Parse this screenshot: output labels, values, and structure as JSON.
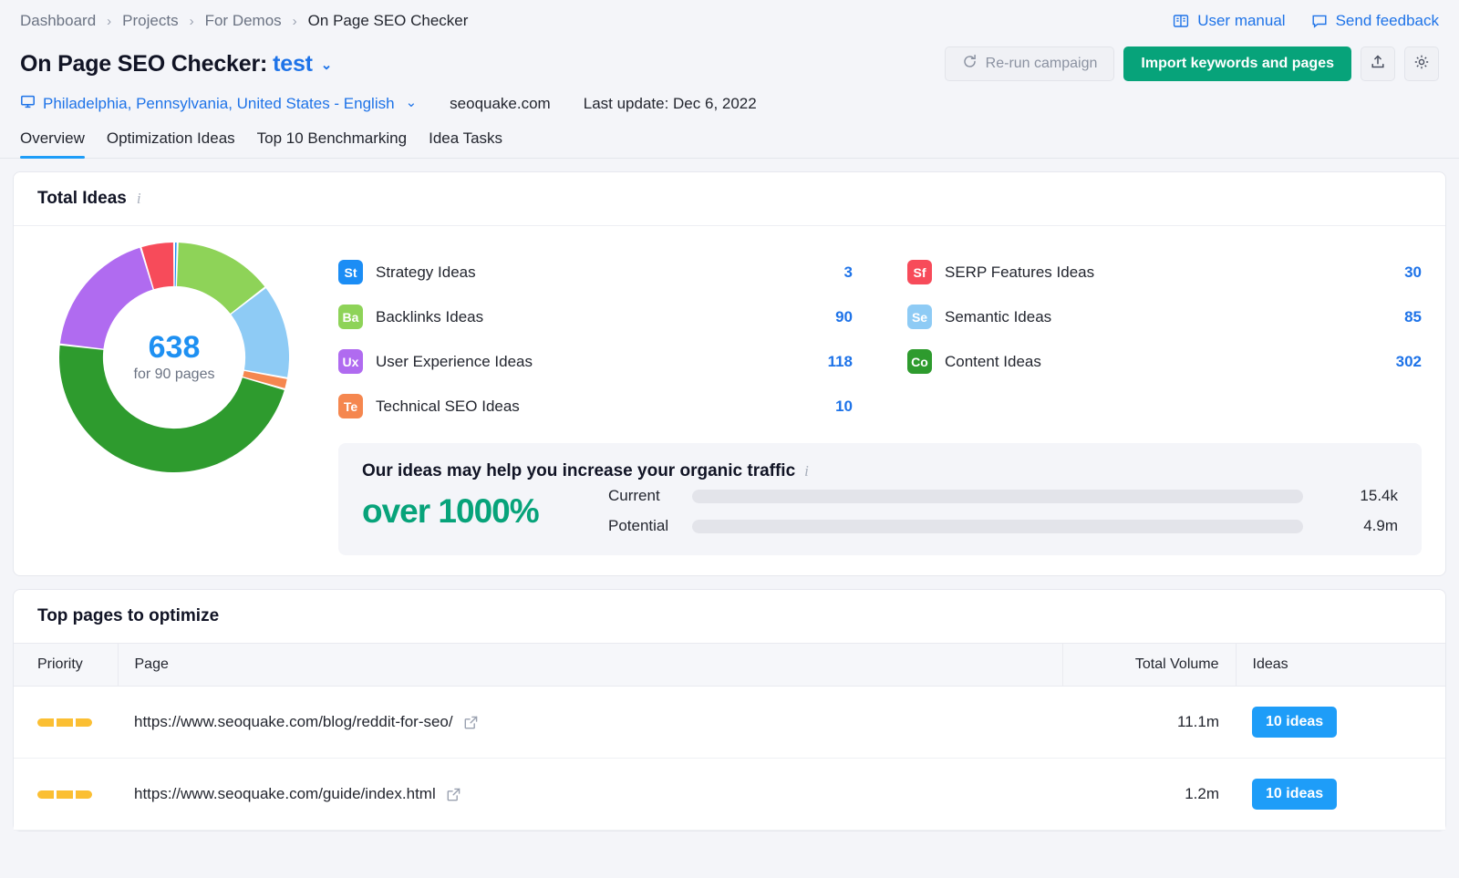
{
  "breadcrumb": {
    "items": [
      {
        "label": "Dashboard",
        "current": false
      },
      {
        "label": "Projects",
        "current": false
      },
      {
        "label": "For Demos",
        "current": false
      },
      {
        "label": "On Page SEO Checker",
        "current": true
      }
    ],
    "separator": "›"
  },
  "header_links": {
    "user_manual": "User manual",
    "send_feedback": "Send feedback"
  },
  "title": {
    "prefix": "On Page SEO Checker:",
    "campaign": "test",
    "caret": "⌄"
  },
  "actions": {
    "rerun": "Re-run campaign",
    "import": "Import keywords and pages"
  },
  "meta": {
    "location": "Philadelphia, Pennsylvania, United States - English",
    "caret": "⌄",
    "domain": "seoquake.com",
    "last_update": "Last update: Dec 6, 2022"
  },
  "tabs": [
    {
      "label": "Overview",
      "active": true
    },
    {
      "label": "Optimization Ideas",
      "active": false
    },
    {
      "label": "Top 10 Benchmarking",
      "active": false
    },
    {
      "label": "Idea Tasks",
      "active": false
    }
  ],
  "total_ideas": {
    "card_title": "Total Ideas",
    "info": "i",
    "donut": {
      "total": "638",
      "subtitle": "for 90 pages"
    },
    "legend_left": [
      {
        "abbr": "St",
        "label": "Strategy Ideas",
        "value": "3",
        "color": "#1b8df5"
      },
      {
        "abbr": "Ba",
        "label": "Backlinks Ideas",
        "value": "90",
        "color": "#8ed358"
      },
      {
        "abbr": "Ux",
        "label": "User Experience Ideas",
        "value": "118",
        "color": "#b06bf0"
      },
      {
        "abbr": "Te",
        "label": "Technical SEO Ideas",
        "value": "10",
        "color": "#f5874f"
      }
    ],
    "legend_right": [
      {
        "abbr": "Sf",
        "label": "SERP Features Ideas",
        "value": "30",
        "color": "#f74b5a"
      },
      {
        "abbr": "Se",
        "label": "Semantic Ideas",
        "value": "85",
        "color": "#8ecbf5"
      },
      {
        "abbr": "Co",
        "label": "Content Ideas",
        "value": "302",
        "color": "#2e9b2e"
      }
    ]
  },
  "traffic": {
    "title": "Our ideas may help you increase your organic traffic",
    "info": "i",
    "percent": "over 1000%",
    "rows": [
      {
        "label": "Current",
        "value": "15.4k",
        "fill_pct": 0,
        "filled": false
      },
      {
        "label": "Potential",
        "value": "4.9m",
        "fill_pct": 100,
        "filled": true
      }
    ]
  },
  "top_pages": {
    "card_title": "Top pages to optimize",
    "columns": [
      "Priority",
      "Page",
      "Total Volume",
      "Ideas"
    ],
    "rows": [
      {
        "priority_segments": 3,
        "url": "https://www.seoquake.com/blog/reddit-for-seo/",
        "total_volume": "11.1m",
        "ideas": "10 ideas"
      },
      {
        "priority_segments": 3,
        "url": "https://www.seoquake.com/guide/index.html",
        "total_volume": "1.2m",
        "ideas": "10 ideas"
      }
    ]
  },
  "chart_data": {
    "type": "pie",
    "title": "Total Ideas",
    "total": 638,
    "subtitle": "for 90 pages",
    "categories": [
      "Strategy Ideas",
      "Backlinks Ideas",
      "Semantic Ideas",
      "Technical SEO Ideas",
      "Content Ideas",
      "User Experience Ideas",
      "SERP Features Ideas"
    ],
    "values": [
      3,
      90,
      85,
      10,
      302,
      118,
      30
    ],
    "colors": [
      "#1b8df5",
      "#8ed358",
      "#8ecbf5",
      "#f5874f",
      "#2e9b2e",
      "#b06bf0",
      "#f74b5a"
    ],
    "start_angle_deg": 0,
    "direction": "clockwise",
    "inner_radius_ratio": 0.62,
    "legend": "right"
  }
}
